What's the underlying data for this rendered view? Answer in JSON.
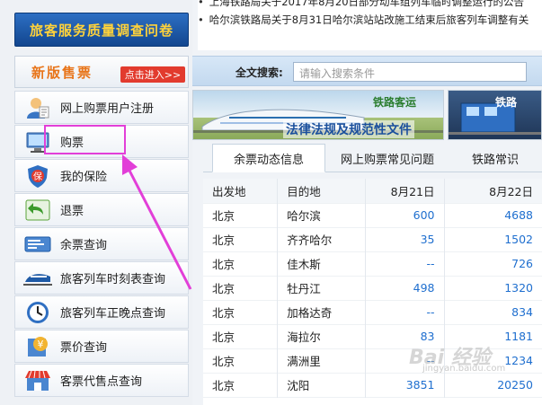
{
  "news": {
    "item1": "上海铁路局关于2017年8月20日部分动车组列车临时调整运行的公告",
    "item2": "哈尔滨铁路局关于8月31日哈尔滨站站改施工结束后旅客列车调整有关"
  },
  "left": {
    "survey_label": "旅客服务质量调查问卷",
    "new_title": "新版售票",
    "new_enter": "点击进入>>",
    "menu": [
      {
        "label": "网上购票用户注册",
        "icon": "user-register-icon"
      },
      {
        "label": "购票",
        "icon": "computer-icon"
      },
      {
        "label": "我的保险",
        "icon": "insurance-shield-icon"
      },
      {
        "label": "退票",
        "icon": "return-arrow-icon"
      },
      {
        "label": "余票查询",
        "icon": "ticket-icon"
      },
      {
        "label": "旅客列车时刻表查询",
        "icon": "train-icon"
      },
      {
        "label": "旅客列车正晚点查询",
        "icon": "clock-icon"
      },
      {
        "label": "票价查询",
        "icon": "price-icon"
      },
      {
        "label": "客票代售点查询",
        "icon": "shop-icon"
      }
    ]
  },
  "search": {
    "label": "全文搜索:",
    "placeholder": "请输入搜索条件"
  },
  "banners": {
    "b1_small": "铁路客运",
    "b1_big": "法律法规及规范性文件",
    "b2_small": "铁路"
  },
  "tabs": [
    "余票动态信息",
    "网上购票常见问题",
    "铁路常识"
  ],
  "table": {
    "headers": [
      "出发地",
      "目的地",
      "8月21日",
      "8月22日"
    ],
    "rows": [
      [
        "北京",
        "哈尔滨",
        "600",
        "4688"
      ],
      [
        "北京",
        "齐齐哈尔",
        "35",
        "1502"
      ],
      [
        "北京",
        "佳木斯",
        "--",
        "726"
      ],
      [
        "北京",
        "牡丹江",
        "498",
        "1320"
      ],
      [
        "北京",
        "加格达奇",
        "--",
        "834"
      ],
      [
        "北京",
        "海拉尔",
        "83",
        "1181"
      ],
      [
        "北京",
        "满洲里",
        "--",
        "1234"
      ],
      [
        "北京",
        "沈阳",
        "3851",
        "20250"
      ]
    ]
  },
  "watermark": "Bai 经验",
  "watermark_url": "jingyan.baidu.com",
  "colors": {
    "highlight": "#e23fd8",
    "link_blue": "#1f6fcf",
    "survey_bg": "#1a58a8",
    "survey_text": "#ffd23a"
  }
}
